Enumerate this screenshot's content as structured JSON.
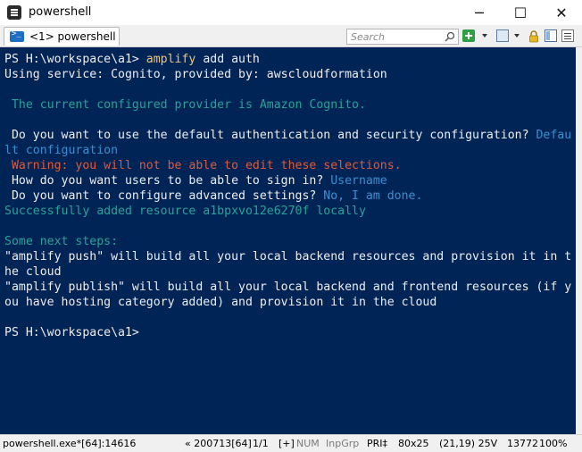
{
  "window": {
    "title": "powershell",
    "minimize_glyph": "─",
    "maximize_glyph": "☐",
    "close_glyph": "✕"
  },
  "toolbar": {
    "tab_label": "<1> powershell",
    "search_placeholder": "Search",
    "icons": [
      "new-console-icon",
      "layout-icon",
      "lock-icon",
      "panel-icon",
      "menu-icon"
    ]
  },
  "terminal": {
    "colors": {
      "background": "#012456",
      "text": "#eeedf0",
      "command": "#f0c674",
      "info": "#2aa198",
      "answer": "#3a8fd0",
      "warning": "#e05a3a"
    },
    "lines": [
      {
        "segments": [
          {
            "text": "PS H:\\workspace\\a1> ",
            "color": "w"
          },
          {
            "text": "amplify",
            "color": "cmd"
          },
          {
            "text": " add auth",
            "color": "w"
          }
        ]
      },
      {
        "segments": [
          {
            "text": "Using service: Cognito, provided by: awscloudformation",
            "color": "w"
          }
        ]
      },
      {
        "segments": []
      },
      {
        "segments": [
          {
            "text": " The current configured provider is Amazon Cognito.",
            "color": "teal"
          }
        ]
      },
      {
        "segments": []
      },
      {
        "segments": [
          {
            "text": " Do you want to use the default authentication and security configuration? ",
            "color": "w"
          },
          {
            "text": "Defau",
            "color": "blue"
          }
        ]
      },
      {
        "segments": [
          {
            "text": "lt configuration",
            "color": "blue"
          }
        ]
      },
      {
        "segments": [
          {
            "text": " Warning: you will not be able to edit these selections.",
            "color": "red"
          }
        ]
      },
      {
        "segments": [
          {
            "text": " How do you want users to be able to sign in? ",
            "color": "w"
          },
          {
            "text": "Username",
            "color": "blue"
          }
        ]
      },
      {
        "segments": [
          {
            "text": " Do you want to configure advanced settings? ",
            "color": "w"
          },
          {
            "text": "No, I am done.",
            "color": "blue"
          }
        ]
      },
      {
        "segments": [
          {
            "text": "Successfully added resource a1bpxvo12e6270f locally",
            "color": "teal"
          }
        ]
      },
      {
        "segments": []
      },
      {
        "segments": [
          {
            "text": "Some next steps:",
            "color": "teal"
          }
        ]
      },
      {
        "segments": [
          {
            "text": "\"amplify push\" will build all your local backend resources and provision it in t",
            "color": "w"
          }
        ]
      },
      {
        "segments": [
          {
            "text": "he cloud",
            "color": "w"
          }
        ]
      },
      {
        "segments": [
          {
            "text": "\"amplify publish\" will build all your local backend and frontend resources (if y",
            "color": "w"
          }
        ]
      },
      {
        "segments": [
          {
            "text": "ou have hosting category added) and provision it in the cloud",
            "color": "w"
          }
        ]
      },
      {
        "segments": []
      },
      {
        "segments": [
          {
            "text": "PS H:\\workspace\\a1>",
            "color": "w"
          }
        ]
      }
    ]
  },
  "status": {
    "process": "powershell.exe*[64]:14616",
    "build": "« 200713[64]",
    "console": "1/1",
    "mode": "[+]",
    "num": "NUM",
    "inp": "InpGrp",
    "pri": "PRI‡",
    "size": "80x25",
    "cursor": "(21,19) 25V",
    "pid": "13772",
    "zoom": "100%"
  }
}
